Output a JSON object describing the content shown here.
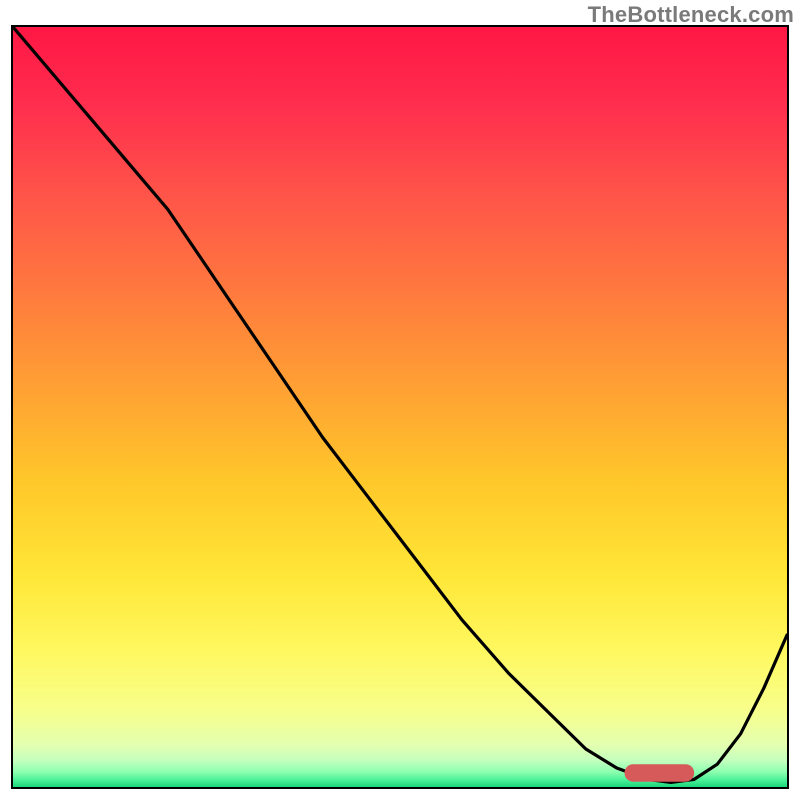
{
  "watermark": "TheBottleneck.com",
  "colors": {
    "curve": "#000000",
    "marker": "#d75a5a",
    "border": "#000000"
  },
  "chart_data": {
    "type": "line",
    "title": "",
    "xlabel": "",
    "ylabel": "",
    "xlim": [
      0,
      100
    ],
    "ylim": [
      0,
      100
    ],
    "grid": false,
    "series": [
      {
        "name": "curve",
        "x": [
          0,
          5,
          10,
          15,
          20,
          24,
          28,
          34,
          40,
          46,
          52,
          58,
          64,
          70,
          74,
          78,
          82,
          85,
          88,
          91,
          94,
          97,
          100
        ],
        "y": [
          100,
          94,
          88,
          82,
          76,
          70,
          64,
          55,
          46,
          38,
          30,
          22,
          15,
          9,
          5,
          2.5,
          1,
          0.6,
          1,
          3,
          7,
          13,
          20
        ]
      }
    ],
    "valley_marker": {
      "x_start": 79,
      "x_end": 88,
      "y": 0.7,
      "height": 2.3
    },
    "gradient_stops": [
      {
        "offset": 0.0,
        "color": "#ff1744"
      },
      {
        "offset": 0.1,
        "color": "#ff2d4e"
      },
      {
        "offset": 0.22,
        "color": "#ff5449"
      },
      {
        "offset": 0.35,
        "color": "#ff7a3e"
      },
      {
        "offset": 0.48,
        "color": "#ffa233"
      },
      {
        "offset": 0.6,
        "color": "#ffc82a"
      },
      {
        "offset": 0.72,
        "color": "#ffe637"
      },
      {
        "offset": 0.82,
        "color": "#fff85f"
      },
      {
        "offset": 0.9,
        "color": "#f7ff8c"
      },
      {
        "offset": 0.945,
        "color": "#e3ffb0"
      },
      {
        "offset": 0.965,
        "color": "#c4ffbf"
      },
      {
        "offset": 0.98,
        "color": "#8dffb0"
      },
      {
        "offset": 0.992,
        "color": "#44ef95"
      },
      {
        "offset": 1.0,
        "color": "#1bd67a"
      }
    ]
  }
}
